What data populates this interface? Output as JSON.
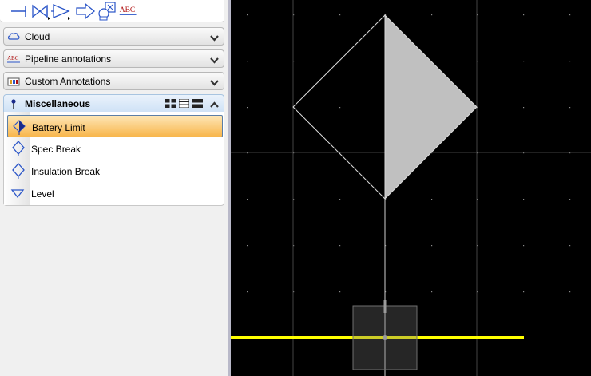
{
  "toolbar": {
    "tools": [
      "line-end-tool-icon",
      "valve-tool-icon",
      "flow-arrow-tool-icon",
      "block-arrow-tool-icon",
      "component-tool-icon",
      "abc-text-tool-icon"
    ],
    "abc_text": "ABC"
  },
  "palette": {
    "sections": [
      {
        "label": "Cloud",
        "icon": "cloud-icon",
        "expanded": false
      },
      {
        "label": "Pipeline annotations",
        "icon": "abc-annotation-icon",
        "expanded": false
      },
      {
        "label": "Custom Annotations",
        "icon": "custom-annotation-icon",
        "expanded": false
      }
    ],
    "active_section": {
      "label": "Miscellaneous",
      "icon": "pin-icon",
      "expanded": true
    },
    "items": [
      {
        "label": "Battery Limit",
        "icon": "battery-limit-icon",
        "selected": true
      },
      {
        "label": "Spec Break",
        "icon": "spec-break-icon",
        "selected": false
      },
      {
        "label": "Insulation Break",
        "icon": "insulation-break-icon",
        "selected": false
      },
      {
        "label": "Level",
        "icon": "level-triangle-icon",
        "selected": false
      }
    ]
  },
  "colors": {
    "canvas_bg": "#000000",
    "selected_item": "#f8b64c",
    "pipe_line": "#ffff00",
    "symbol_fill": "#c0c0c0"
  }
}
